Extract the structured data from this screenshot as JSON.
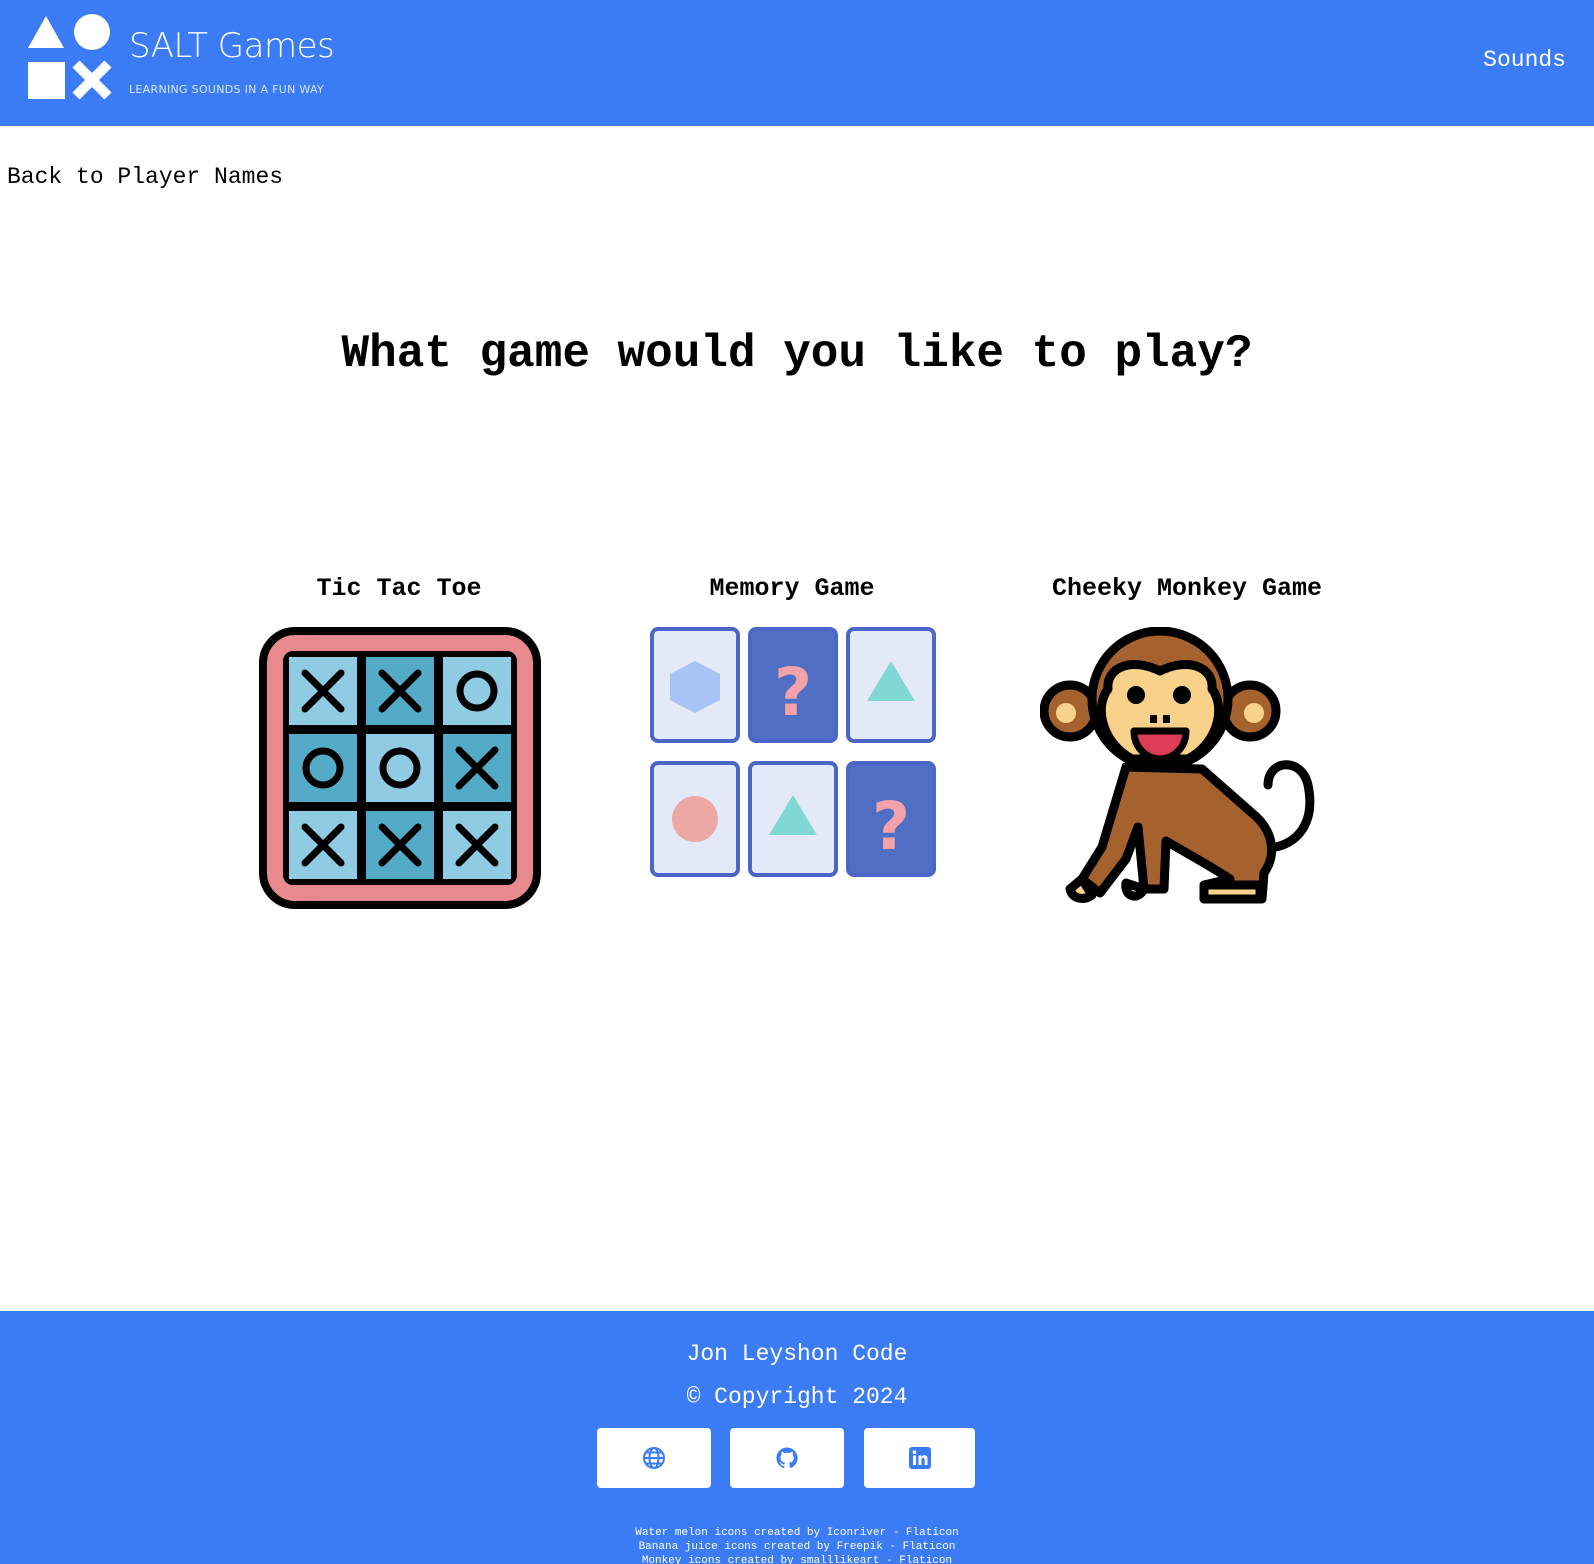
{
  "header": {
    "brand_title": "SALT Games",
    "brand_tagline": "LEARNING SOUNDS IN A FUN WAY",
    "nav_sounds": "Sounds"
  },
  "main": {
    "back_link": "Back to Player Names",
    "title": "What game would you like to play?",
    "games": [
      {
        "title": "Tic Tac Toe",
        "icon": "tic-tac-toe-icon"
      },
      {
        "title": "Memory Game",
        "icon": "memory-cards-icon"
      },
      {
        "title": "Cheeky Monkey Game",
        "icon": "monkey-icon"
      }
    ]
  },
  "footer": {
    "author": "Jon Leyshon Code",
    "copyright": "© Copyright 2024",
    "social_links": [
      {
        "icon": "globe-icon"
      },
      {
        "icon": "github-icon"
      },
      {
        "icon": "linkedin-icon"
      }
    ],
    "credits": [
      "Water melon icons created by Iconriver - Flaticon",
      "Banana juice icons created by Freepik - Flaticon",
      "Monkey icons created by smalllikeart - Flaticon"
    ]
  },
  "colors": {
    "brand_blue": "#3b7cf4",
    "white": "#ffffff",
    "ttt_border": "#e8898e",
    "ttt_light": "#90cbe4",
    "ttt_dark": "#54abc8",
    "card_dark": "#4f6ec4",
    "card_light": "#e4e9f7",
    "monkey_brown": "#a5622f",
    "monkey_face": "#f8d28a"
  }
}
